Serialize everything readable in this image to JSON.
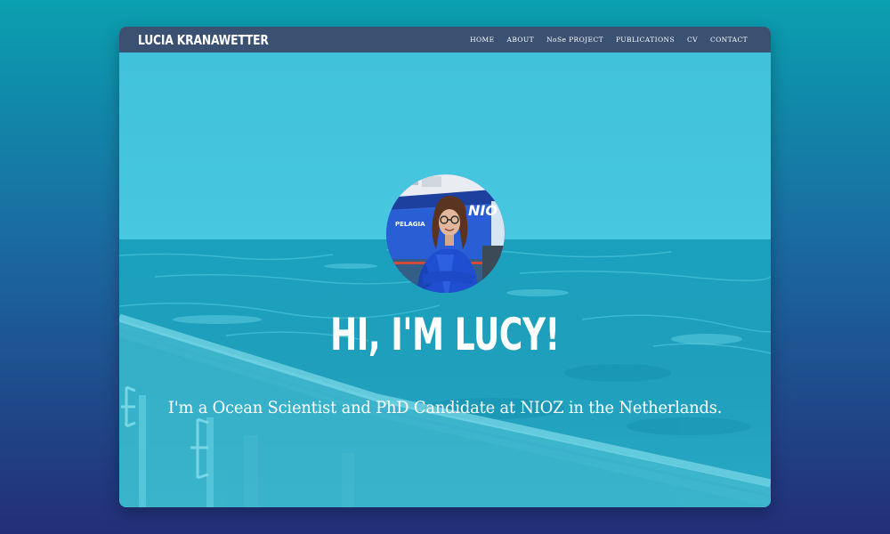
{
  "site": {
    "brand": "LUCIA KRANAWETTER"
  },
  "nav": {
    "items": [
      {
        "label": "HOME"
      },
      {
        "label": "ABOUT"
      },
      {
        "label": "NoSe PROJECT"
      },
      {
        "label": "PUBLICATIONS"
      },
      {
        "label": "CV"
      },
      {
        "label": "CONTACT"
      }
    ]
  },
  "hero": {
    "headline": "HI, I'M LUCY!",
    "tagline": "I'm a Ocean Scientist and PhD Candidate at NIOZ in the Netherlands.",
    "avatar": {
      "ship_name": "PELAGIA",
      "hull_text": "NIO"
    }
  },
  "colors": {
    "navbar": "#3b5172",
    "hero_tint": "#3ec3d9",
    "page_gradient_top": "#0aa0b0",
    "page_gradient_bottom": "#232e78"
  }
}
